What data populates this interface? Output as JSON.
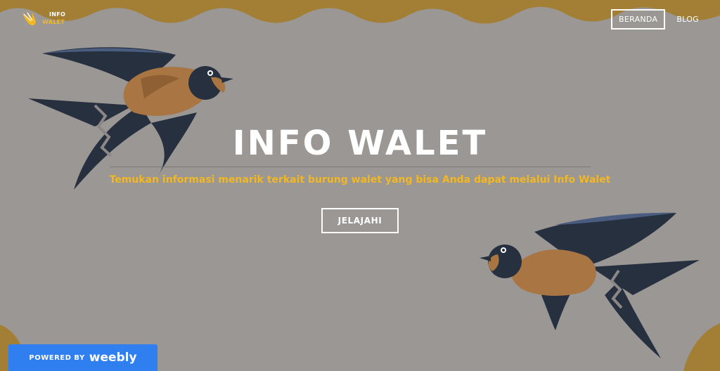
{
  "logo": {
    "line1": "INFO",
    "line2": "WALET",
    "icon": "swallow-logo-icon"
  },
  "nav": {
    "items": [
      {
        "label": "BERANDA",
        "active": true
      },
      {
        "label": "BLOG",
        "active": false
      }
    ]
  },
  "hero": {
    "title": "INFO WALET",
    "subtitle": "Temukan informasi menarik terkait burung walet yang bisa Anda dapat melalui Info Walet",
    "cta_label": "JELAJAHI"
  },
  "footer_badge": {
    "powered_label": "POWERED BY",
    "brand": "weebly"
  },
  "colors": {
    "background": "#9a9795",
    "wave": "#a27f34",
    "accent_yellow": "#f2b721",
    "bird_dark": "#27303f",
    "bird_breast": "#a87543",
    "badge_blue": "#2f7ff0"
  }
}
